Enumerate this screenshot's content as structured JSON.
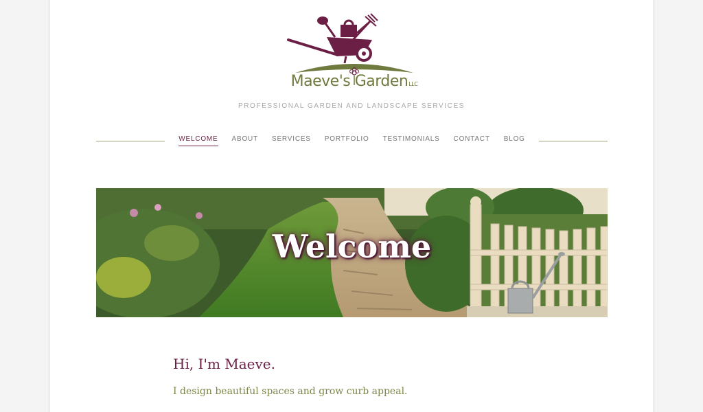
{
  "brand": {
    "name": "Maeve's Garden",
    "suffix": "LLC",
    "tagline": "PROFESSIONAL GARDEN AND LANDSCAPE SERVICES"
  },
  "nav": {
    "items": [
      {
        "label": "WELCOME",
        "active": true
      },
      {
        "label": "ABOUT",
        "active": false
      },
      {
        "label": "SERVICES",
        "active": false
      },
      {
        "label": "PORTFOLIO",
        "active": false
      },
      {
        "label": "TESTIMONIALS",
        "active": false
      },
      {
        "label": "CONTACT",
        "active": false
      },
      {
        "label": "BLOG",
        "active": false
      }
    ]
  },
  "hero": {
    "title": "Welcome"
  },
  "intro": {
    "heading": "Hi, I'm Maeve.",
    "text": "I design beautiful spaces and grow curb appeal."
  },
  "colors": {
    "accent": "#6b1f45",
    "olive": "#6f7a3f",
    "page_bg": "#f4f4f4"
  },
  "icons": [
    "wheelbarrow-logo-icon",
    "flower-icon",
    "watering-can-icon"
  ]
}
